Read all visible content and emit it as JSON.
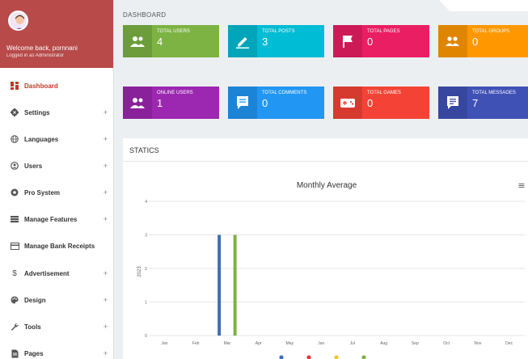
{
  "sidebar": {
    "welcome": "Welcome back, pornnani",
    "logged_in": "Logged in as Administrator",
    "items": [
      {
        "label": "Dashboard",
        "plus": ""
      },
      {
        "label": "Settings",
        "plus": "+"
      },
      {
        "label": "Languages",
        "plus": "+"
      },
      {
        "label": "Users",
        "plus": "+"
      },
      {
        "label": "Pro System",
        "plus": "+"
      },
      {
        "label": "Manage Features",
        "plus": "+"
      },
      {
        "label": "Manage Bank Receipts",
        "plus": ""
      },
      {
        "label": "Advertisement",
        "plus": "+"
      },
      {
        "label": "Design",
        "plus": "+"
      },
      {
        "label": "Tools",
        "plus": "+"
      },
      {
        "label": "Pages",
        "plus": "+"
      }
    ]
  },
  "header": {
    "title": "DASHBOARD"
  },
  "cards": [
    {
      "title": "TOTAL USERS",
      "value": "4",
      "color": "#7cb342",
      "icon": "users-icon"
    },
    {
      "title": "TOTAL POSTS",
      "value": "3",
      "color": "#00bcd4",
      "icon": "pencil-icon"
    },
    {
      "title": "TOTAL PAGES",
      "value": "0",
      "color": "#e91e63",
      "icon": "flag-icon"
    },
    {
      "title": "TOTAL GROUPS",
      "value": "0",
      "color": "#ff9800",
      "icon": "groups-icon"
    },
    {
      "title": "ONLINE USERS",
      "value": "1",
      "color": "#9c27b0",
      "icon": "users-icon"
    },
    {
      "title": "TOTAL COMMENTS",
      "value": "0",
      "color": "#2196f3",
      "icon": "comment-icon"
    },
    {
      "title": "TOTAL GAMES",
      "value": "0",
      "color": "#f44336",
      "icon": "gamepad-icon"
    },
    {
      "title": "TOTAL MESSAGES",
      "value": "7",
      "color": "#3f51b5",
      "icon": "message-icon"
    }
  ],
  "stats": {
    "title": "STATICS",
    "menu_glyph": "≡"
  },
  "chart_data": {
    "type": "bar",
    "title": "Monthly Average",
    "ylabel": "2023",
    "xlabel": "",
    "categories": [
      "Jan",
      "Feb",
      "Mar",
      "Apr",
      "May",
      "Jun",
      "Jul",
      "Aug",
      "Sep",
      "Oct",
      "Nov",
      "Dec"
    ],
    "ylim": [
      0,
      4
    ],
    "yticks": [
      "0",
      "1",
      "2",
      "3",
      "4"
    ],
    "series": [
      {
        "color": "#3f6fb5",
        "values": [
          0,
          0,
          3,
          0,
          0,
          0,
          0,
          0,
          0,
          0,
          0,
          0
        ]
      },
      {
        "color": "#e53935",
        "values": [
          0,
          0,
          0,
          0,
          0,
          0,
          0,
          0,
          0,
          0,
          0,
          0
        ]
      },
      {
        "color": "#fbc02d",
        "values": [
          0,
          0,
          0,
          0,
          0,
          0,
          0,
          0,
          0,
          0,
          0,
          0
        ]
      },
      {
        "color": "#7cb342",
        "values": [
          0,
          0,
          3,
          0,
          0,
          0,
          0,
          0,
          0,
          0,
          0,
          0
        ]
      }
    ],
    "legend_position": "bottom"
  }
}
